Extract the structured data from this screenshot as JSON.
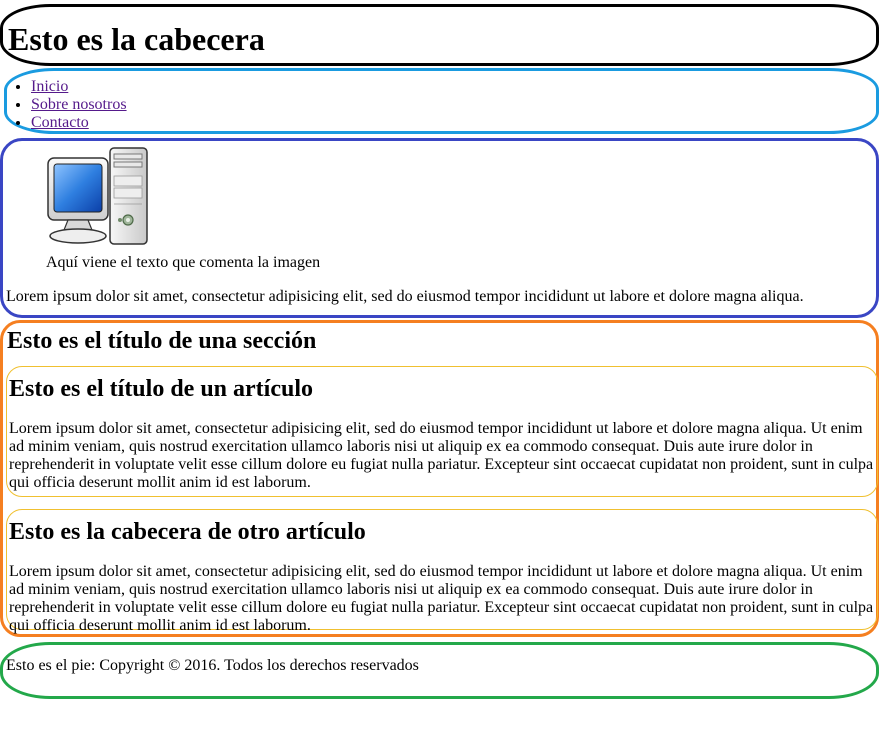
{
  "header": {
    "title": "Esto es la cabecera"
  },
  "nav": {
    "items": [
      {
        "label": "Inicio"
      },
      {
        "label": "Sobre nosotros"
      },
      {
        "label": "Contacto"
      }
    ]
  },
  "figure": {
    "icon": "desktop-computer-icon",
    "caption": "Aquí viene el texto que comenta la imagen",
    "text": "Lorem ipsum dolor sit amet, consectetur adipisicing elit, sed do eiusmod tempor incididunt ut labore et dolore magna aliqua."
  },
  "section": {
    "title": "Esto es el título de una sección",
    "articles": [
      {
        "title": "Esto es el título de un artículo",
        "body": "Lorem ipsum dolor sit amet, consectetur adipisicing elit, sed do eiusmod tempor incididunt ut labore et dolore magna aliqua. Ut enim ad minim veniam, quis nostrud exercitation ullamco laboris nisi ut aliquip ex ea commodo consequat. Duis aute irure dolor in reprehenderit in voluptate velit esse cillum dolore eu fugiat nulla pariatur. Excepteur sint occaecat cupidatat non proident, sunt in culpa qui officia deserunt mollit anim id est laborum."
      },
      {
        "title": "Esto es la cabecera de otro artículo",
        "body": "Lorem ipsum dolor sit amet, consectetur adipisicing elit, sed do eiusmod tempor incididunt ut labore et dolore magna aliqua. Ut enim ad minim veniam, quis nostrud exercitation ullamco laboris nisi ut aliquip ex ea commodo consequat. Duis aute irure dolor in reprehenderit in voluptate velit esse cillum dolore eu fugiat nulla pariatur. Excepteur sint occaecat cupidatat non proident, sunt in culpa qui officia deserunt mollit anim id est laborum."
      }
    ]
  },
  "footer": {
    "text": "Esto es el pie: Copyright © 2016. Todos los derechos reservados"
  },
  "colors": {
    "header_border": "#000000",
    "nav_border": "#1a9be0",
    "figure_border": "#3a46c4",
    "section_border": "#f57f20",
    "article_border": "#f0c030",
    "footer_border": "#23a84a",
    "link": "#551a8b"
  }
}
